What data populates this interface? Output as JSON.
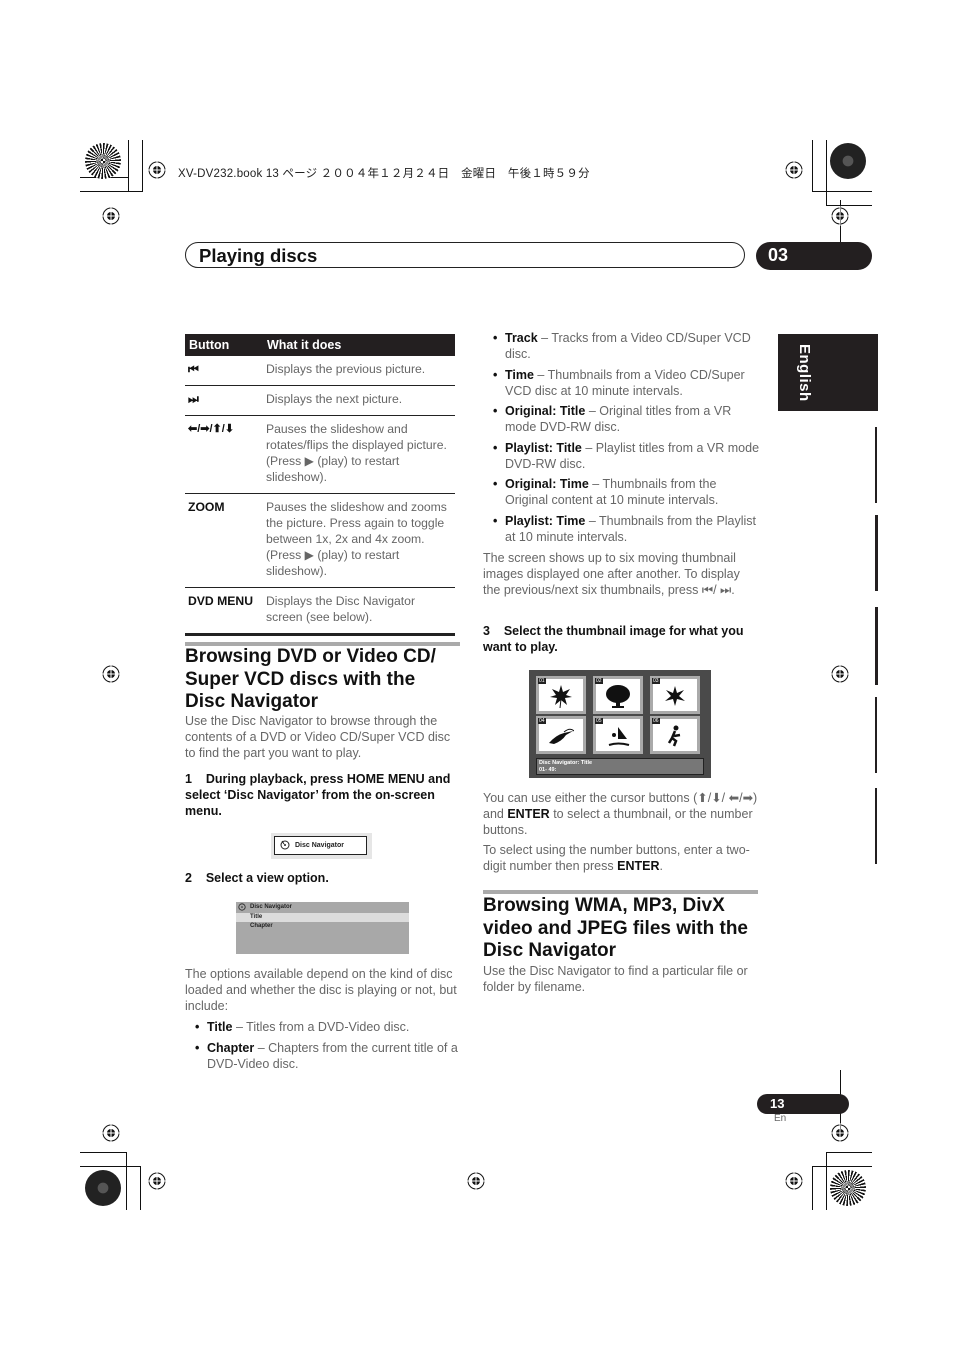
{
  "print_header": "XV-DV232.book  13 ページ  ２００４年１２月２４日　金曜日　午後１時５９分",
  "chapter": {
    "title": "Playing discs",
    "number": "03"
  },
  "language_tab": "English",
  "button_table": {
    "headers": [
      "Button",
      "What it does"
    ],
    "rows": [
      {
        "button": "⏮",
        "button_icon": "previous-track-icon",
        "description": "Displays the previous picture."
      },
      {
        "button": "⏭",
        "button_icon": "next-track-icon",
        "description": "Displays the next picture."
      },
      {
        "button": "⬅/➡/⬆/⬇",
        "button_icon": "cursor-arrows-icon",
        "description": "Pauses the slideshow and rotates/flips the displayed picture. (Press ▶ (play) to restart slideshow)."
      },
      {
        "button": "ZOOM",
        "description": "Pauses the slideshow and zooms the picture. Press again to toggle between 1x, 2x and 4x zoom. (Press ▶ (play) to restart slideshow)."
      },
      {
        "button": "DVD MENU",
        "description": "Displays the Disc Navigator screen (see below)."
      }
    ]
  },
  "section1": {
    "heading": "Browsing DVD or Video CD/ Super VCD discs with the Disc Navigator",
    "intro": "Use the Disc Navigator to browse through the contents of a DVD or Video CD/Super VCD disc to find the part you want to play.",
    "step1": "1    During playback, press HOME MENU and select ‘Disc Navigator’ from the on-screen menu.",
    "osd_menu_item": "Disc Navigator",
    "step2": "2    Select a view option.",
    "osd_view": {
      "title": "Disc Navigator",
      "options": [
        "Title",
        "Chapter"
      ],
      "selected": "Title"
    },
    "options_intro": "The options available depend on the kind of disc loaded and whether the disc is playing or not, but include:",
    "options": [
      {
        "term": "Title",
        "desc": " – Titles from a DVD-Video disc."
      },
      {
        "term": "Chapter",
        "desc": " – Chapters from the current title of a DVD-Video disc."
      },
      {
        "term": "Track",
        "desc": " – Tracks from a Video CD/Super VCD disc."
      },
      {
        "term": "Time",
        "desc": " – Thumbnails from a Video CD/Super VCD disc at 10 minute intervals."
      },
      {
        "term": "Original: Title",
        "desc": " – Original titles from a VR mode DVD-RW disc."
      },
      {
        "term": "Playlist: Title",
        "desc": " – Playlist titles from a VR mode DVD-RW disc."
      },
      {
        "term": "Original: Time",
        "desc": " – Thumbnails from the Original content at 10 minute intervals."
      },
      {
        "term": "Playlist: Time",
        "desc": " – Thumbnails from the Playlist at 10 minute intervals."
      }
    ],
    "screen_note": "The screen shows up to six moving thumbnail images displayed one after another. To display the previous/next six thumbnails, press ⏮/ ⏭.",
    "step3": "3    Select the thumbnail image for what you want to play.",
    "osd_thumbs": {
      "thumbnails": [
        {
          "num": "01",
          "icon": "leaf-icon"
        },
        {
          "num": "02",
          "icon": "tree-icon"
        },
        {
          "num": "03",
          "icon": "flower-icon"
        },
        {
          "num": "04",
          "icon": "toucan-icon"
        },
        {
          "num": "05",
          "icon": "windsurfer-icon"
        },
        {
          "num": "06",
          "icon": "skater-icon"
        }
      ],
      "status_title": "Disc Navigator: Title",
      "status_range": "01- 49:"
    },
    "cursor_note_pre": "You can use either the cursor buttons (⬆/⬇/ ⬅/➡) and ",
    "cursor_note_key": "ENTER",
    "cursor_note_post": " to select a thumbnail, or the number buttons.",
    "number_note_pre": "To select using the number buttons, enter a two-digit number then press ",
    "number_note_key": "ENTER",
    "number_note_post": "."
  },
  "section2": {
    "heading": "Browsing WMA, MP3, DivX video and JPEG files with the Disc Navigator",
    "intro": "Use the Disc Navigator to find a particular file or folder by filename."
  },
  "footer": {
    "page_number": "13",
    "language_code": "En"
  }
}
